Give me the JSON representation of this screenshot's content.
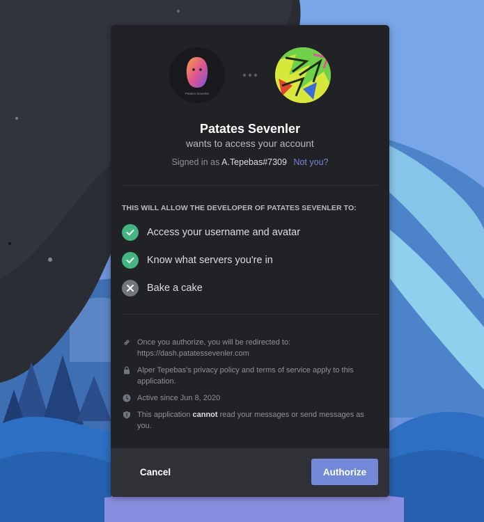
{
  "colors": {
    "modal_bg": "#202225",
    "footer_bg": "#2f3136",
    "accent": "#7289da",
    "granted": "#43b581",
    "denied": "#72767d"
  },
  "application": {
    "name": "Patates Sevenler",
    "avatar_caption": "Patates Sevenler",
    "subtitle": "wants to access your account"
  },
  "account": {
    "signed_in_prefix": "Signed in as",
    "username": "A.Tepebas#7309",
    "not_you_link": "Not you?"
  },
  "permissions": {
    "header": "THIS WILL ALLOW THE DEVELOPER OF PATATES SEVENLER TO:",
    "scopes": [
      {
        "label": "Access your username and avatar",
        "granted": true,
        "icon": "check-icon"
      },
      {
        "label": "Know what servers you're in",
        "granted": true,
        "icon": "check-icon"
      },
      {
        "label": "Bake a cake",
        "granted": false,
        "icon": "x-icon"
      }
    ]
  },
  "info": {
    "redirect_text": "Once you authorize, you will be redirected to:",
    "redirect_url": "https://dash.patatessevenler.com",
    "policy_text": "Alper Tepebas's privacy policy and terms of service apply to this application.",
    "active_since": "Active since Jun 8, 2020",
    "cannot_prefix": "This application",
    "cannot_word": "cannot",
    "cannot_suffix": "read your messages or send messages as you."
  },
  "footer": {
    "cancel_label": "Cancel",
    "authorize_label": "Authorize"
  }
}
